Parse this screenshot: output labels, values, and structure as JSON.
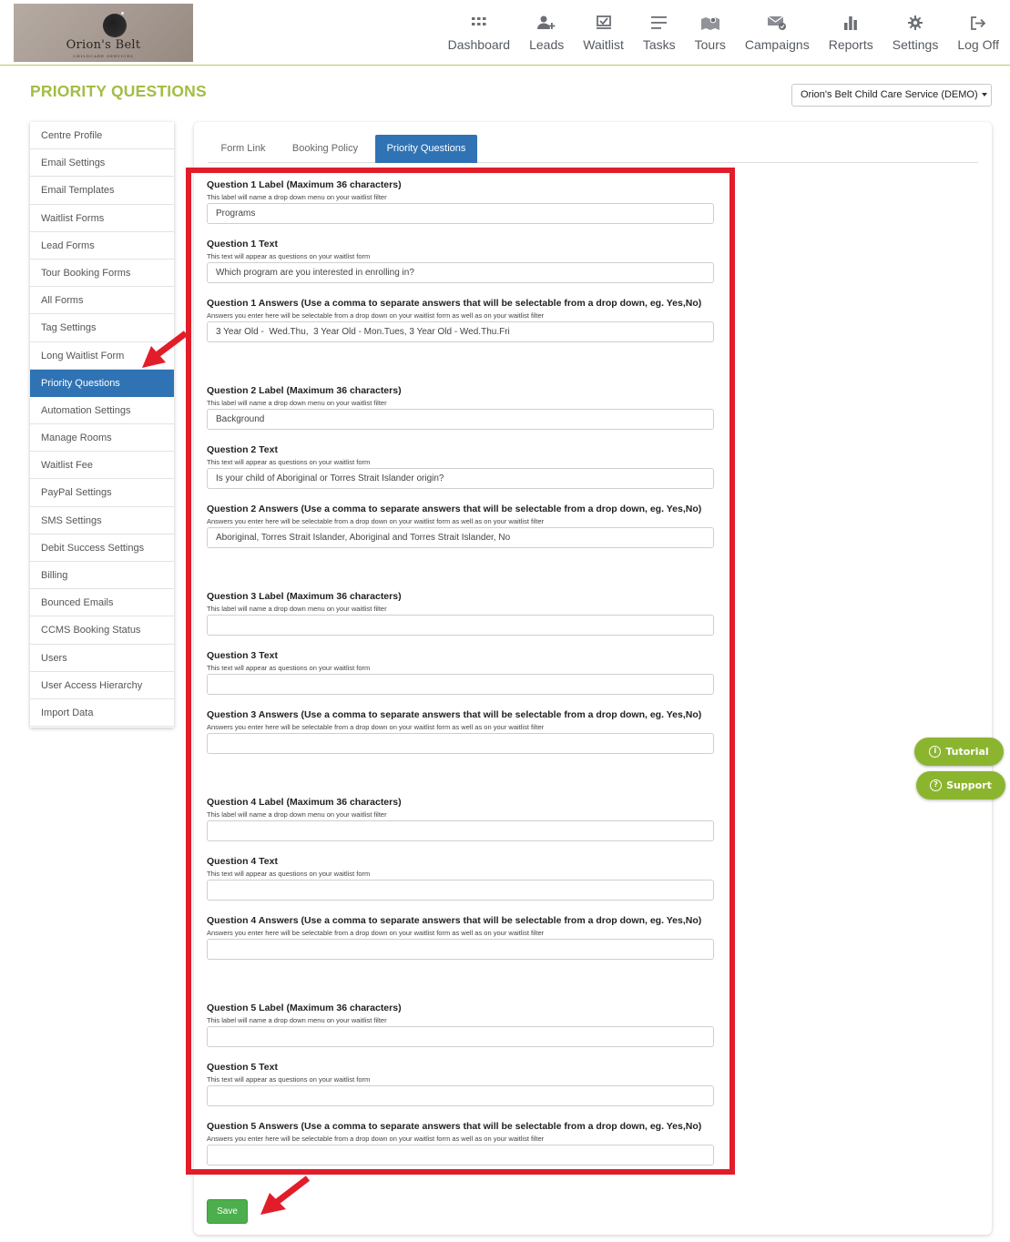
{
  "brand": {
    "name": "Orion's Belt",
    "tagline": "CHILDCARE SERVICES"
  },
  "nav": [
    {
      "label": "Dashboard",
      "icon": "grid-icon"
    },
    {
      "label": "Leads",
      "icon": "add-user-icon"
    },
    {
      "label": "Waitlist",
      "icon": "checkbox-tray-icon"
    },
    {
      "label": "Tasks",
      "icon": "list-icon"
    },
    {
      "label": "Tours",
      "icon": "map-pin-icon"
    },
    {
      "label": "Campaigns",
      "icon": "mail-check-icon"
    },
    {
      "label": "Reports",
      "icon": "bar-chart-icon"
    },
    {
      "label": "Settings",
      "icon": "gear-icon"
    },
    {
      "label": "Log Off",
      "icon": "logout-icon"
    }
  ],
  "page_title": "PRIORITY QUESTIONS",
  "centre_select": "Orion's Belt Child Care Service (DEMO)",
  "sidebar": [
    "Centre Profile",
    "Email Settings",
    "Email Templates",
    "Waitlist Forms",
    "Lead Forms",
    "Tour Booking Forms",
    "All Forms",
    "Tag Settings",
    "Long Waitlist Form",
    "Priority Questions",
    "Automation Settings",
    "Manage Rooms",
    "Waitlist Fee",
    "PayPal Settings",
    "SMS Settings",
    "Debit Success Settings",
    "Billing",
    "Bounced Emails",
    "CCMS Booking Status",
    "Users",
    "User Access Hierarchy",
    "Import Data"
  ],
  "sidebar_active": "Priority Questions",
  "tabs": [
    "Form Link",
    "Booking Policy",
    "Priority Questions"
  ],
  "tab_active": "Priority Questions",
  "fields": [
    {
      "label": "Question 1 Label (Maximum 36 characters)",
      "help": "This label will name a drop down menu on your waitlist filter",
      "value": "Programs"
    },
    {
      "label": "Question 1 Text",
      "help": "This text will appear as questions on your waitlist form",
      "value": "Which program are you interested in enrolling in?"
    },
    {
      "label": "Question 1 Answers (Use a comma to separate answers that will be selectable from a drop down, eg. Yes,No)",
      "help": "Answers you enter here will be selectable from a drop down on your waitlist form as well as on your waitlist filter",
      "value": "3 Year Old -  Wed.Thu,  3 Year Old - Mon.Tues, 3 Year Old - Wed.Thu.Fri"
    },
    {
      "label": "Question 2 Label (Maximum 36 characters)",
      "help": "This label will name a drop down menu on your waitlist filter",
      "value": "Background"
    },
    {
      "label": "Question 2 Text",
      "help": "This text will appear as questions on your waitlist form",
      "value": "Is your child of Aboriginal or Torres Strait Islander origin?"
    },
    {
      "label": "Question 2 Answers (Use a comma to separate answers that will be selectable from a drop down, eg. Yes,No)",
      "help": "Answers you enter here will be selectable from a drop down on your waitlist form as well as on your waitlist filter",
      "value": "Aboriginal, Torres Strait Islander, Aboriginal and Torres Strait Islander, No"
    },
    {
      "label": "Question 3 Label (Maximum 36 characters)",
      "help": "This label will name a drop down menu on your waitlist filter",
      "value": ""
    },
    {
      "label": "Question 3 Text",
      "help": "This text will appear as questions on your waitlist form",
      "value": ""
    },
    {
      "label": "Question 3 Answers (Use a comma to separate answers that will be selectable from a drop down, eg. Yes,No)",
      "help": "Answers you enter here will be selectable from a drop down on your waitlist form as well as on your waitlist filter",
      "value": ""
    },
    {
      "label": "Question 4 Label (Maximum 36 characters)",
      "help": "This label will name a drop down menu on your waitlist filter",
      "value": ""
    },
    {
      "label": "Question 4 Text",
      "help": "This text will appear as questions on your waitlist form",
      "value": ""
    },
    {
      "label": "Question 4 Answers (Use a comma to separate answers that will be selectable from a drop down, eg. Yes,No)",
      "help": "Answers you enter here will be selectable from a drop down on your waitlist form as well as on your waitlist filter",
      "value": ""
    },
    {
      "label": "Question 5 Label (Maximum 36 characters)",
      "help": "This label will name a drop down menu on your waitlist filter",
      "value": ""
    },
    {
      "label": "Question 5 Text",
      "help": "This text will appear as questions on your waitlist form",
      "value": ""
    },
    {
      "label": "Question 5 Answers (Use a comma to separate answers that will be selectable from a drop down, eg. Yes,No)",
      "help": "Answers you enter here will be selectable from a drop down on your waitlist form as well as on your waitlist filter",
      "value": ""
    }
  ],
  "save_label": "Save",
  "floating": {
    "tutorial": "Tutorial",
    "support": "Support"
  },
  "colors": {
    "accent_green": "#a2bd43",
    "active_blue": "#2f73b4",
    "annotation_red": "#e21d2a",
    "save_green": "#4cae4c",
    "float_green": "#8cb52f"
  }
}
